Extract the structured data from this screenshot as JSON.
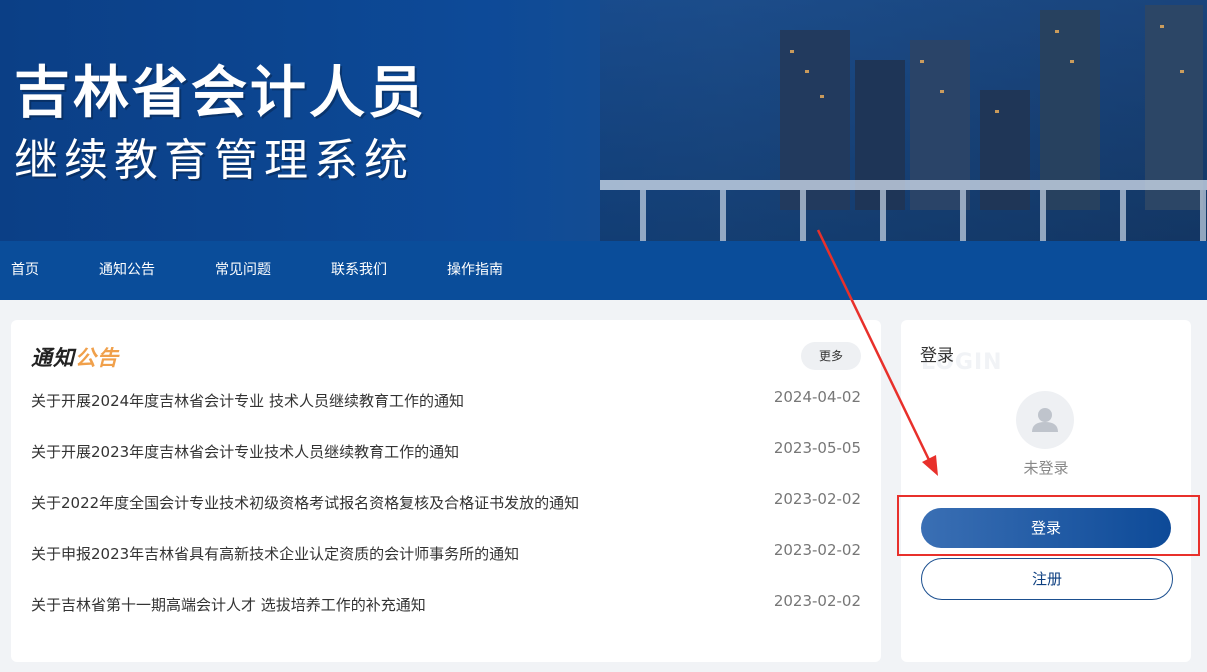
{
  "banner": {
    "title": "吉林省会计人员",
    "subtitle": "继续教育管理系统"
  },
  "nav": {
    "items": [
      {
        "label": "首页"
      },
      {
        "label": "通知公告"
      },
      {
        "label": "常见问题"
      },
      {
        "label": "联系我们"
      },
      {
        "label": "操作指南"
      }
    ]
  },
  "notices": {
    "heading_part1": "通知",
    "heading_part2": "公告",
    "more_label": "更多",
    "items": [
      {
        "title": "关于开展2024年度吉林省会计专业 技术人员继续教育工作的通知",
        "date": "2024-04-02"
      },
      {
        "title": "关于开展2023年度吉林省会计专业技术人员继续教育工作的通知",
        "date": "2023-05-05"
      },
      {
        "title": "关于2022年度全国会计专业技术初级资格考试报名资格复核及合格证书发放的通知",
        "date": "2023-02-02"
      },
      {
        "title": "关于申报2023年吉林省具有高新技术企业认定资质的会计师事务所的通知",
        "date": "2023-02-02"
      },
      {
        "title": "关于吉林省第十一期高端会计人才 选拔培养工作的补充通知",
        "date": "2023-02-02"
      }
    ]
  },
  "login": {
    "title": "登录",
    "bg_word": "LOGIN",
    "status": "未登录",
    "login_label": "登录",
    "register_label": "注册"
  },
  "colors": {
    "nav_bg": "#0a4d9a",
    "accent": "#f0a04b",
    "annotation": "#e8302b"
  },
  "icons": {
    "avatar": "user-icon"
  }
}
